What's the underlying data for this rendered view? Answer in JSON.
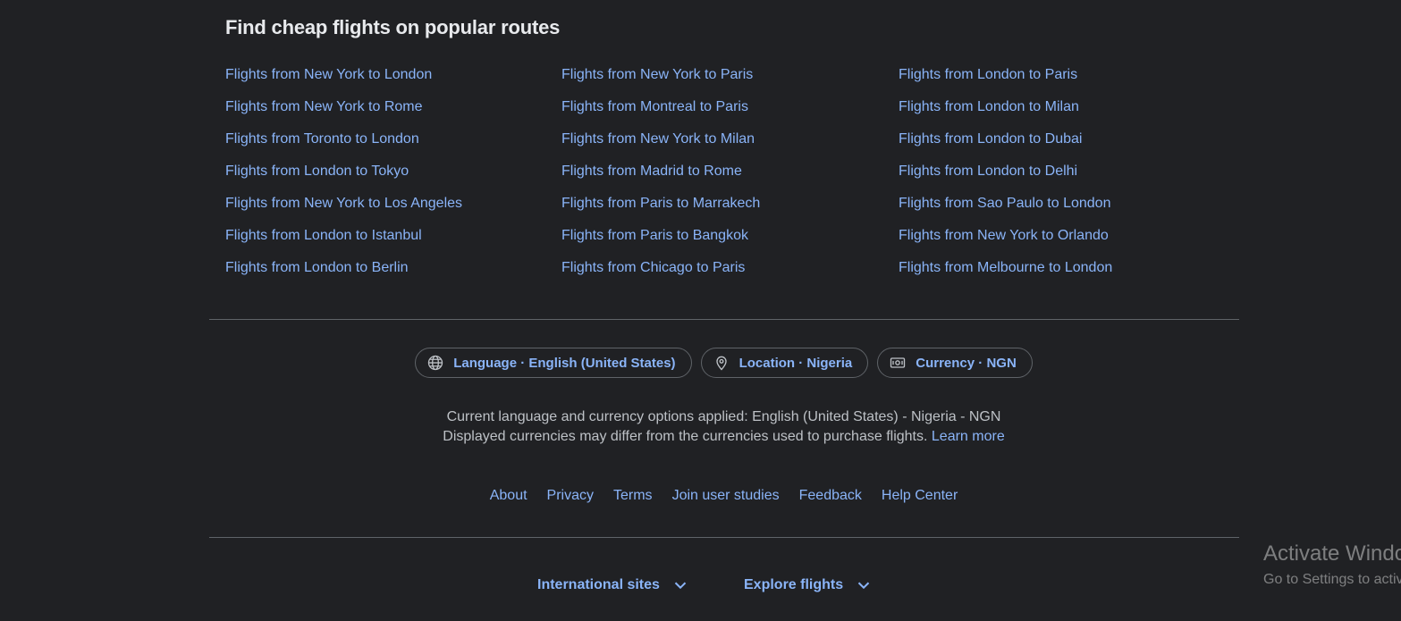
{
  "popular_routes": {
    "heading": "Find cheap flights on popular routes",
    "columns": [
      [
        "Flights from New York to London",
        "Flights from New York to Rome",
        "Flights from Toronto to London",
        "Flights from London to Tokyo",
        "Flights from New York to Los Angeles",
        "Flights from London to Istanbul",
        "Flights from London to Berlin"
      ],
      [
        "Flights from New York to Paris",
        "Flights from Montreal to Paris",
        "Flights from New York to Milan",
        "Flights from Madrid to Rome",
        "Flights from Paris to Marrakech",
        "Flights from Paris to Bangkok",
        "Flights from Chicago to Paris"
      ],
      [
        "Flights from London to Paris",
        "Flights from London to Milan",
        "Flights from London to Dubai",
        "Flights from London to Delhi",
        "Flights from Sao Paulo to London",
        "Flights from New York to Orlando",
        "Flights from Melbourne to London"
      ]
    ]
  },
  "settings": {
    "language_label": "Language · English (United States)",
    "location_label": "Location · Nigeria",
    "currency_label": "Currency · NGN",
    "icons": [
      "globe-icon",
      "location-pin-icon",
      "currency-icon"
    ]
  },
  "notice": {
    "line1": "Current language and currency options applied: English (United States) - Nigeria - NGN",
    "line2": "Displayed currencies may differ from the currencies used to purchase flights.",
    "learn_more": "Learn more"
  },
  "footer_links": {
    "about": "About",
    "privacy": "Privacy",
    "terms": "Terms",
    "join_user_studies": "Join user studies",
    "feedback": "Feedback",
    "help_center": "Help Center"
  },
  "bottom": {
    "international_sites": "International sites",
    "explore_flights": "Explore flights",
    "icon": "chevron-down-icon"
  },
  "watermark": {
    "title": "Activate Windows",
    "subtitle": "Go to Settings to activate Windows."
  },
  "colors": {
    "background": "#202124",
    "link": "#8ab4f8",
    "heading": "#e8eaed",
    "text_secondary": "#bdc1c6",
    "divider": "#5f6368"
  }
}
